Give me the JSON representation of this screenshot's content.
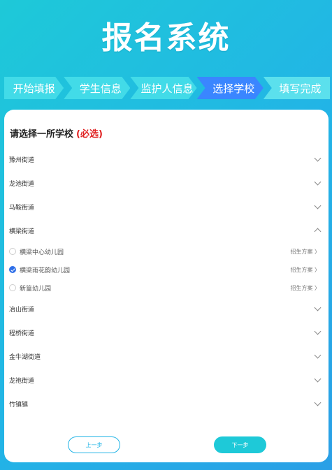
{
  "header": {
    "title": "报名系统"
  },
  "steps": [
    {
      "label": "开始填报"
    },
    {
      "label": "学生信息"
    },
    {
      "label": "监护人信息"
    },
    {
      "label": "选择学校"
    },
    {
      "label": "填写完成"
    }
  ],
  "main": {
    "title": "请选择一所学校",
    "required": "(必选)",
    "districts": [
      {
        "name": "豫州街道"
      },
      {
        "name": "龙池街道"
      },
      {
        "name": "马鞍街道"
      },
      {
        "name": "横梁街道"
      }
    ],
    "schools": [
      {
        "name": "横梁中心幼儿园",
        "plan": "招生方案 〉"
      },
      {
        "name": "横梁雨花韵幼儿园",
        "plan": "招生方案 〉"
      },
      {
        "name": "新篁幼儿园",
        "plan": "招生方案 〉"
      }
    ],
    "districts_after": [
      {
        "name": "冶山街道"
      },
      {
        "name": "程桥街道"
      },
      {
        "name": "金牛湖街道"
      },
      {
        "name": "龙袍街道"
      },
      {
        "name": "竹镇镇"
      }
    ]
  },
  "buttons": {
    "prev": "上一步",
    "next": "下一步"
  },
  "colors": {
    "accent": "#1ec9d8",
    "active_step": "#3a86ff",
    "required": "#e02020"
  }
}
